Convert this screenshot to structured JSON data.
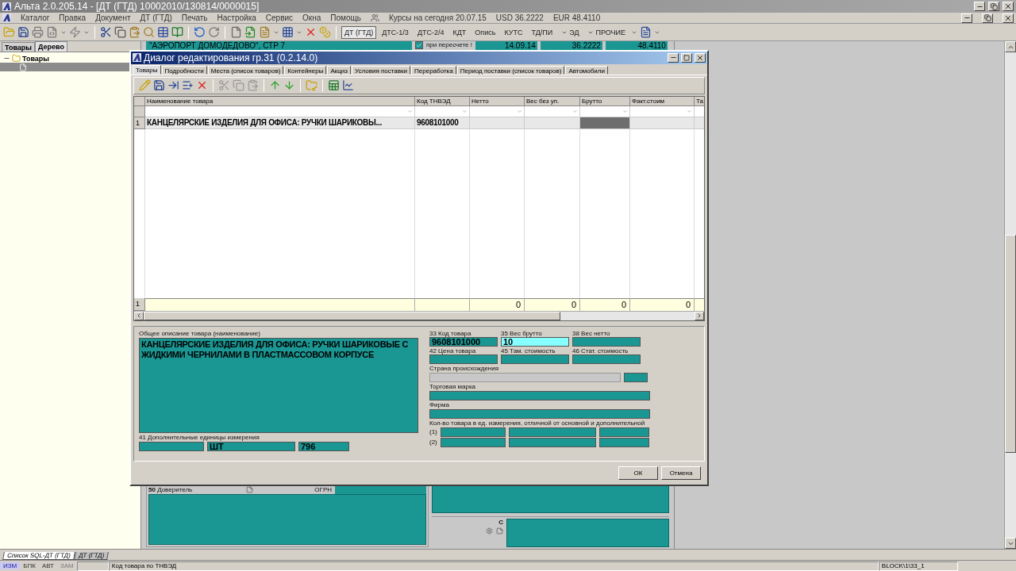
{
  "app_window": {
    "title": "Альта 2.0.205.14 - [ДТ (ГТД) 10002010/130814/0000015]"
  },
  "menu": [
    "Каталог",
    "Правка",
    "Документ",
    "ДТ (ГТД)",
    "Печать",
    "Настройка",
    "Сервис",
    "Окна",
    "Помощь"
  ],
  "rates": {
    "label": "Курсы на сегодня 20.07.15",
    "usd": "USD 36.2222",
    "eur": "EUR 48.4110"
  },
  "toolbar": {
    "doc_buttons": [
      {
        "label": "ДТ (ГТД)",
        "selected": true,
        "dropdown": false
      },
      {
        "label": "ДТС-1/3",
        "selected": false,
        "dropdown": false
      },
      {
        "label": "ДТС-2/4",
        "selected": false,
        "dropdown": false
      },
      {
        "label": "КДТ",
        "selected": false,
        "dropdown": false
      },
      {
        "label": "Опись",
        "selected": false,
        "dropdown": false
      },
      {
        "label": "КУТС",
        "selected": false,
        "dropdown": false
      },
      {
        "label": "ТД/ПИ",
        "selected": false,
        "dropdown": false
      },
      {
        "label": "ЭД",
        "selected": false,
        "dropdown": true
      },
      {
        "label": "ПРОЧИЕ",
        "selected": false,
        "dropdown": true
      }
    ]
  },
  "left_panel": {
    "tabs": [
      {
        "label": "Товары",
        "selected": false
      },
      {
        "label": "Дерево",
        "selected": true
      }
    ],
    "tree": [
      {
        "label": "Товары",
        "expanded": true,
        "selected": false,
        "children": [
          {
            "selected": true
          }
        ]
      }
    ]
  },
  "background_form": {
    "address": "\"АЭРОПОРТ ДОМОДЕДОВО\", СТР 7",
    "recalc": {
      "label": "при пересчете !",
      "checked": true
    },
    "values": [
      "14.09.14",
      "36.2222",
      "48.4110"
    ],
    "principal": {
      "number": "50",
      "label": "Доверитель",
      "ogrn": "ОГРН"
    },
    "section_c": "С"
  },
  "dialog": {
    "title": "Диалог редактирования гр.31 (0.2.14.0)",
    "tabs": [
      {
        "label": "Товары",
        "selected": true
      },
      {
        "label": "Подробности",
        "selected": false
      },
      {
        "label": "Места (список товаров)",
        "selected": false
      },
      {
        "label": "Контейнеры",
        "selected": false
      },
      {
        "label": "Акциз",
        "selected": false
      },
      {
        "label": "Условия поставки",
        "selected": false
      },
      {
        "label": "Переработка",
        "selected": false
      },
      {
        "label": "Период поставки (список товаров)",
        "selected": false
      },
      {
        "label": "Автомобили",
        "selected": false
      }
    ],
    "grid": {
      "columns": [
        "Наименование товара",
        "Код ТНВЭД",
        "Нетто",
        "Вес без уп.",
        "Брутто",
        "Факт.стоим",
        "Та"
      ],
      "rows": [
        {
          "number": "1",
          "cells": [
            {
              "text": "КАНЦЕЛЯРСКИЕ ИЗДЕЛИЯ ДЛЯ ОФИСА: РУЧКИ ШАРИКОВЫ...",
              "focused": false
            },
            {
              "text": "9608101000",
              "focused": false
            },
            {
              "focused": false
            },
            {
              "focused": false
            },
            {
              "focused": true
            },
            {
              "focused": false
            },
            {
              "focused": false
            }
          ]
        }
      ],
      "totals": {
        "number": "1",
        "cells": [
          null,
          null,
          "0",
          "0",
          "0",
          "0",
          null
        ]
      }
    },
    "form": {
      "description": {
        "label": "Общее описание товара (наименование)",
        "value": "КАНЦЕЛЯРСКИЕ ИЗДЕЛИЯ ДЛЯ ОФИСА: РУЧКИ ШАРИКОВЫЕ С ЖИДКИМИ ЧЕРНИЛАМИ В ПЛАСТМАССОВОМ КОРПУСЕ"
      },
      "extra_units": {
        "label": "41 Дополнительные единицы измерения",
        "fields": [
          {
            "focused": false
          },
          {
            "value": "ШТ",
            "focused": false
          },
          {
            "value": "796",
            "focused": false
          }
        ]
      },
      "codes": [
        {
          "label": "33 Код товара",
          "value": "9608101000",
          "focused": false
        },
        {
          "label": "35 Вес брутто",
          "value": "10",
          "focused": true
        },
        {
          "label": "38 Вес нетто",
          "focused": false
        },
        {
          "label": "42 Цена товара",
          "focused": false
        },
        {
          "label": "45 Там. стоимость",
          "focused": false
        },
        {
          "label": "46 Стат. стоимость",
          "focused": false
        }
      ],
      "country": {
        "label": "Страна происхождения",
        "disabled": true
      },
      "trademark": {
        "label": "Торговая марка"
      },
      "firm": {
        "label": "Фирма"
      },
      "quantity": {
        "label": "Кол-во товара в ед. измерения,  отличной от основной и дополнительной",
        "rows": [
          "(1)",
          "(2)"
        ]
      }
    },
    "buttons": [
      "ОК",
      "Отмена"
    ]
  },
  "document_tabs": [
    {
      "label": "Список SQL-ДТ (ГТД)",
      "selected": false
    },
    {
      "label": "ДТ (ГТД)",
      "selected": true
    }
  ],
  "status_bar": {
    "modes": [
      {
        "label": "ИЗМ",
        "active": true,
        "disabled": false
      },
      {
        "label": "БПК",
        "active": false,
        "disabled": false
      },
      {
        "label": "АВТ",
        "active": false,
        "disabled": false
      },
      {
        "label": "ЗАМ",
        "active": false,
        "disabled": true
      }
    ],
    "hint": "Код товара по ТНВЭД",
    "block": "BLOCK\\1\\33_1"
  }
}
